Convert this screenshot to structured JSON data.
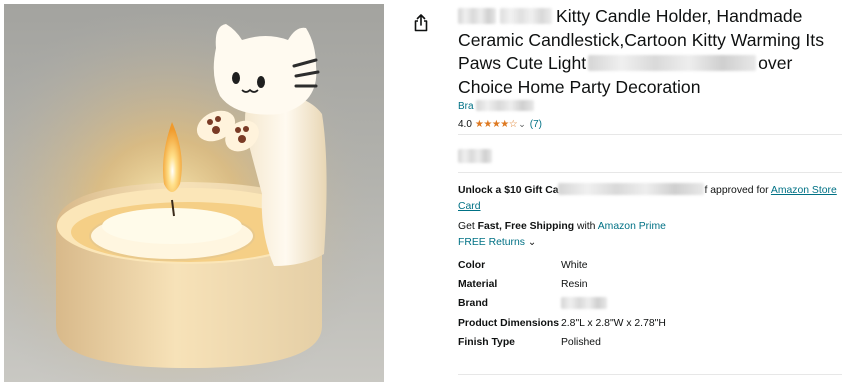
{
  "product": {
    "title_lines": [
      {
        "pre": "",
        "post": "Kitty Candle Holder, Handmade"
      },
      {
        "pre": "Ceramic Candlestick,Cartoon Kitty Warming Its",
        "post": ""
      },
      {
        "pre": "Paws Cute Light",
        "post": "over"
      },
      {
        "pre": "Choice Home Party Decoration",
        "post": ""
      }
    ],
    "brand_prefix": "Bra",
    "rating": "4.0",
    "stars": "★★★★☆",
    "review_count": "(7)"
  },
  "offer": {
    "gift_bold": "Unlock a $10 Gift Ca",
    "gift_mid": "f approved for ",
    "gift_link": "Amazon Store Card",
    "ship_pre": "Get ",
    "ship_bold": "Fast, Free Shipping",
    "ship_mid": " with ",
    "ship_link": "Amazon Prime",
    "returns": "FREE Returns"
  },
  "specs": [
    {
      "key": "Color",
      "value": "White"
    },
    {
      "key": "Material",
      "value": "Resin"
    },
    {
      "key": "Brand",
      "value": ""
    },
    {
      "key": "Product Dimensions",
      "value": "2.8\"L x 2.8\"W x 2.78\"H"
    },
    {
      "key": "Finish Type",
      "value": "Polished"
    }
  ],
  "icons": {
    "share": "share-icon",
    "chevron": "chevron-down-icon",
    "stars": "star-icon"
  },
  "colors": {
    "link": "#007185",
    "star": "#de7921",
    "text": "#0f1111"
  }
}
